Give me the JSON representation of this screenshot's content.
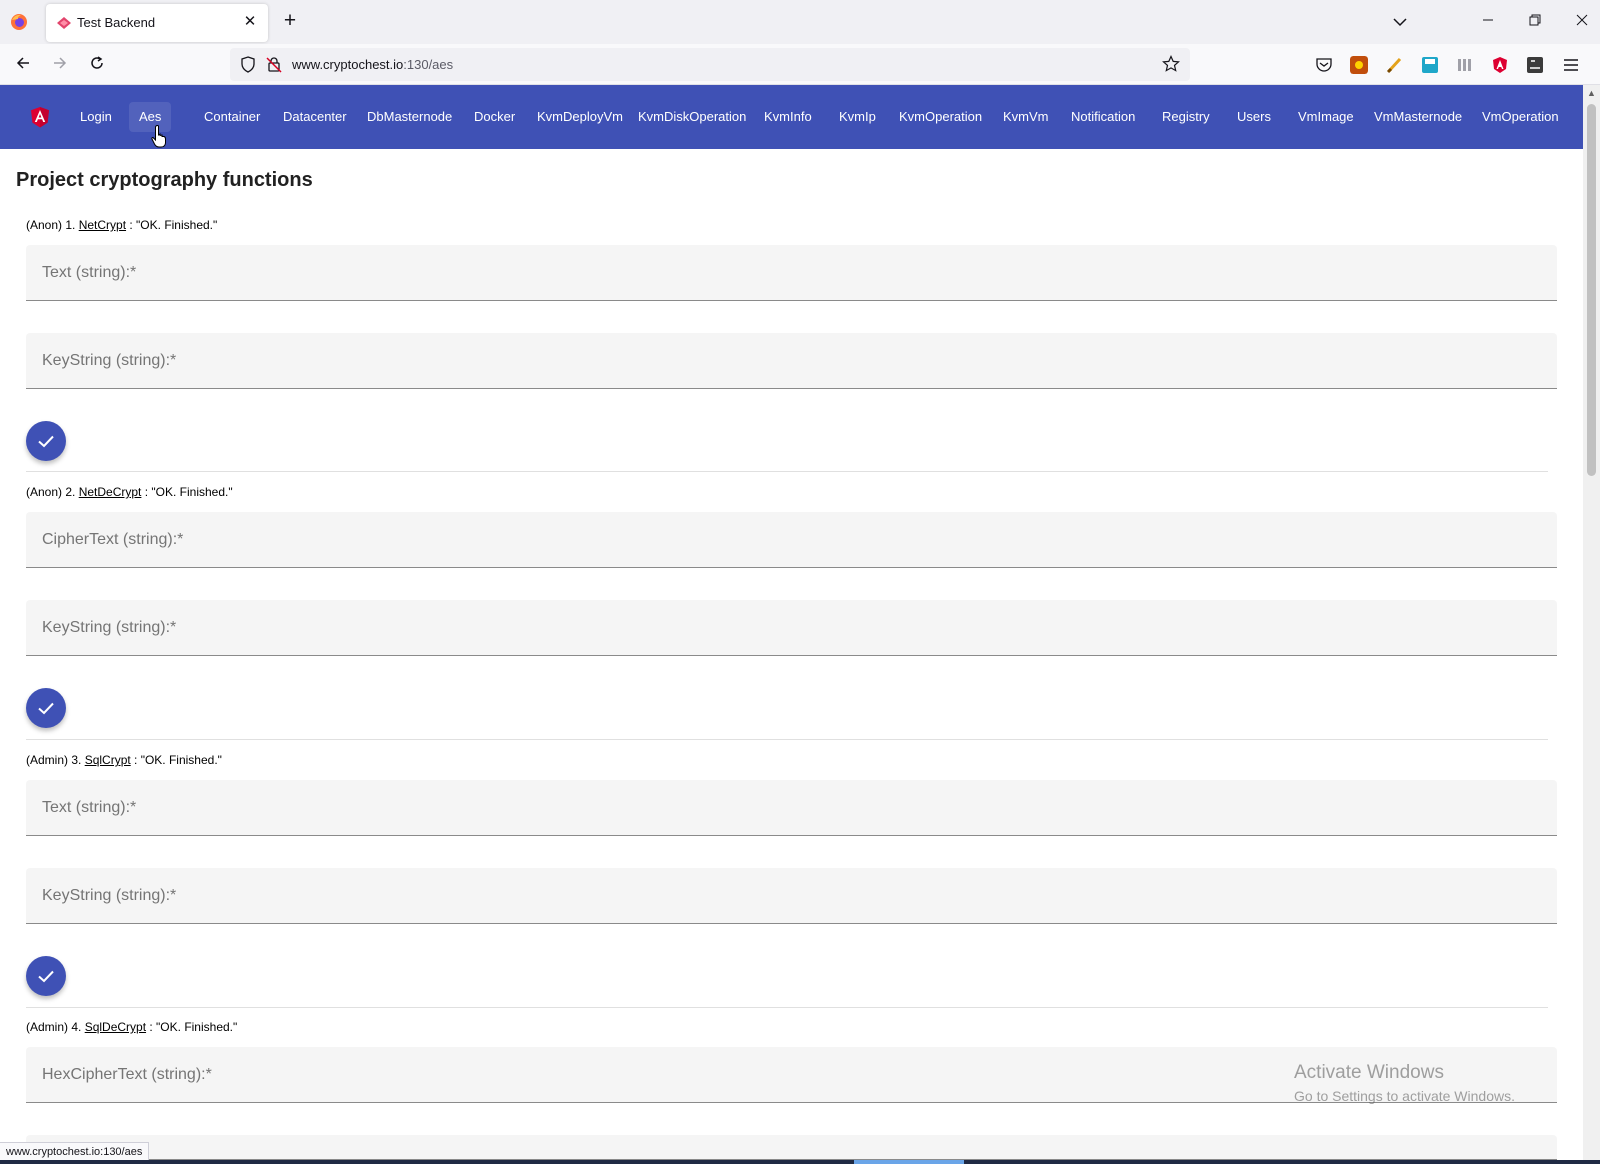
{
  "browser": {
    "tab_title": "Test Backend",
    "tab_close_glyph": "✕",
    "new_tab_glyph": "+",
    "url_host": "www.cryptochest.io",
    "url_path": ":130/aes",
    "status_tip": "www.cryptochest.io:130/aes",
    "icons": {
      "firefox": "firefox-logo-icon",
      "back": "back-arrow-icon",
      "forward": "forward-arrow-icon",
      "reload": "reload-icon",
      "shield": "tracking-shield-icon",
      "lock": "insecure-lock-icon",
      "bookmark": "star-icon",
      "menu": "hamburger-menu-icon"
    }
  },
  "app": {
    "accent_color": "#3f51b5",
    "menu": [
      {
        "label": "Login"
      },
      {
        "label": "Aes"
      },
      {
        "label": "Container"
      },
      {
        "label": "Datacenter"
      },
      {
        "label": "DbMasternode"
      },
      {
        "label": "Docker"
      },
      {
        "label": "KvmDeployVm"
      },
      {
        "label": "KvmDiskOperation"
      },
      {
        "label": "KvmInfo"
      },
      {
        "label": "KvmIp"
      },
      {
        "label": "KvmOperation"
      },
      {
        "label": "KvmVm"
      },
      {
        "label": "Notification"
      },
      {
        "label": "Registry"
      },
      {
        "label": "Users"
      },
      {
        "label": "VmImage"
      },
      {
        "label": "VmMasternode"
      },
      {
        "label": "VmOperation"
      }
    ]
  },
  "page": {
    "title": "Project cryptography functions",
    "sections": [
      {
        "prefix": "(Anon) 1. ",
        "name": "NetCrypt",
        "suffix": " : \"OK. Finished.\"",
        "fields": [
          "Text (string):*",
          "KeyString (string):*"
        ]
      },
      {
        "prefix": "(Anon) 2. ",
        "name": "NetDeCrypt",
        "suffix": " : \"OK. Finished.\"",
        "fields": [
          "CipherText (string):*",
          "KeyString (string):*"
        ]
      },
      {
        "prefix": "(Admin) 3. ",
        "name": "SqlCrypt",
        "suffix": " : \"OK. Finished.\"",
        "fields": [
          "Text (string):*",
          "KeyString (string):*"
        ]
      },
      {
        "prefix": "(Admin) 4. ",
        "name": "SqlDeCrypt",
        "suffix": " : \"OK. Finished.\"",
        "fields": [
          "HexCipherText (string):*"
        ]
      }
    ]
  },
  "watermark": {
    "title": "Activate Windows",
    "subtitle": "Go to Settings to activate Windows."
  }
}
